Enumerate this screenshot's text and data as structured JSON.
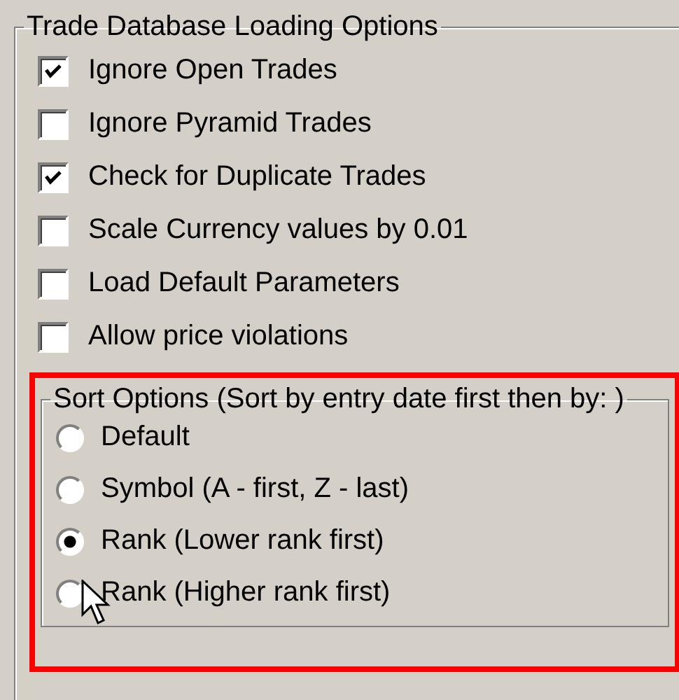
{
  "group": {
    "title": "Trade Database Loading Options"
  },
  "options": [
    {
      "label": "Ignore Open Trades",
      "checked": true
    },
    {
      "label": "Ignore Pyramid Trades",
      "checked": false
    },
    {
      "label": "Check for Duplicate Trades",
      "checked": true
    },
    {
      "label": "Scale Currency values by 0.01",
      "checked": false
    },
    {
      "label": "Load Default Parameters",
      "checked": false
    },
    {
      "label": "Allow price violations",
      "checked": false
    }
  ],
  "sort_group": {
    "title": "Sort Options (Sort by entry date first then by: )",
    "choices": [
      {
        "label": "Default",
        "selected": false
      },
      {
        "label": "Symbol (A - first, Z - last)",
        "selected": false
      },
      {
        "label": "Rank (Lower rank first)",
        "selected": true
      },
      {
        "label": "Rank (Higher rank first)",
        "selected": false
      }
    ]
  }
}
